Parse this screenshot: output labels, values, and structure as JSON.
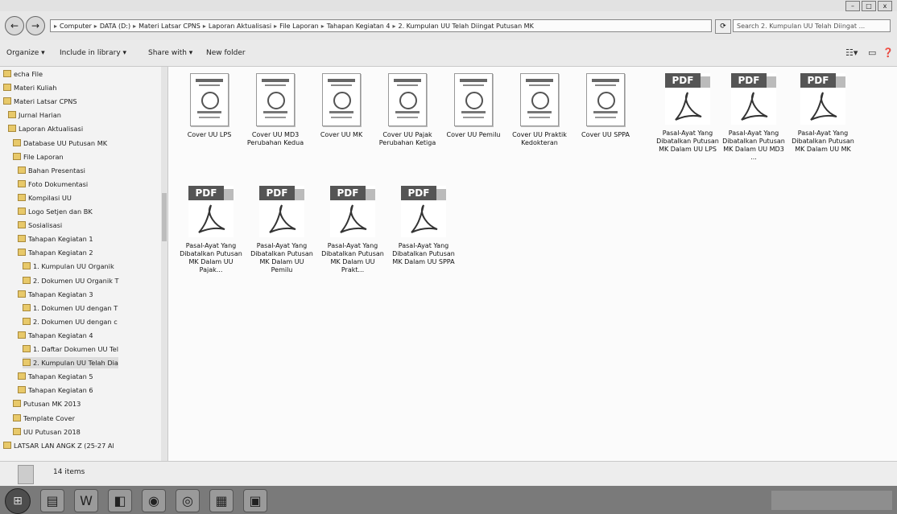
{
  "window": {
    "controls": [
      "–",
      "□",
      "x"
    ]
  },
  "address": {
    "segments": [
      "Computer",
      "DATA (D:)",
      "Materi Latsar CPNS",
      "Laporan Aktualisasi",
      "File Laporan",
      "Tahapan Kegiatan 4",
      "2. Kumpulan UU Telah Diingat Putusan MK"
    ],
    "separator": "▸",
    "search_placeholder": "Search 2. Kumpulan UU Telah Diingat ..."
  },
  "toolbar": {
    "organize": "Organize ▾",
    "include_in_library": "Include in library ▾",
    "share_with": "Share with ▾",
    "new_folder": "New folder"
  },
  "nav": {
    "items": [
      "echa File",
      "Materi Kuliah",
      "Materi Latsar CPNS",
      "Jurnal Harian",
      "Laporan Aktualisasi",
      "Database UU Putusan MK",
      "File Laporan",
      "Bahan Presentasi",
      "Foto Dokumentasi",
      "Kompilasi UU",
      "Logo Setjen dan BK",
      "Sosialisasi",
      "Tahapan Kegiatan 1",
      "Tahapan Kegiatan 2",
      "1. Kumpulan UU Organik",
      "2. Dokumen UU Organik T",
      "Tahapan Kegiatan 3",
      "1. Dokumen UU dengan T",
      "2. Dokumen UU dengan c",
      "Tahapan Kegiatan 4",
      "1. Daftar Dokumen UU Tel",
      "2. Kumpulan UU Telah Dia",
      "Tahapan Kegiatan 5",
      "Tahapan Kegiatan 6",
      "Putusan MK 2013",
      "Template Cover",
      "UU Putusan 2018",
      "LATSAR LAN ANGK Z (25-27 Al"
    ]
  },
  "files": [
    {
      "name": "Cover UU LPS",
      "type": "cover"
    },
    {
      "name": "Cover UU MD3 Perubahan Kedua",
      "type": "cover"
    },
    {
      "name": "Cover UU MK",
      "type": "cover"
    },
    {
      "name": "Cover UU Pajak Perubahan Ketiga",
      "type": "cover"
    },
    {
      "name": "Cover UU Pemilu",
      "type": "cover"
    },
    {
      "name": "Cover UU Praktik Kedokteran",
      "type": "cover"
    },
    {
      "name": "Cover UU SPPA",
      "type": "cover"
    },
    {
      "name": "Pasal-Ayat Yang Dibatalkan Putusan MK Dalam UU LPS",
      "type": "pdf"
    },
    {
      "name": "Pasal-Ayat Yang Dibatalkan Putusan MK Dalam UU MD3 ...",
      "type": "pdf"
    },
    {
      "name": "Pasal-Ayat Yang Dibatalkan Putusan MK Dalam UU MK",
      "type": "pdf"
    },
    {
      "name": "Pasal-Ayat Yang Dibatalkan Putusan MK Dalam UU Pajak...",
      "type": "pdf"
    },
    {
      "name": "Pasal-Ayat Yang Dibatalkan Putusan MK Dalam UU Pemilu",
      "type": "pdf"
    },
    {
      "name": "Pasal-Ayat Yang Dibatalkan Putusan MK Dalam UU Prakt...",
      "type": "pdf"
    },
    {
      "name": "Pasal-Ayat Yang Dibatalkan Putusan MK Dalam UU SPPA",
      "type": "pdf"
    }
  ],
  "pdf_badge": "PDF",
  "status": {
    "count": "14 items"
  },
  "taskbar": {
    "icons": [
      "start-orb-icon",
      "explorer-icon",
      "word-icon",
      "firefox-icon",
      "chrome-icon",
      "grid-app-icon",
      "photo-app-icon"
    ]
  }
}
